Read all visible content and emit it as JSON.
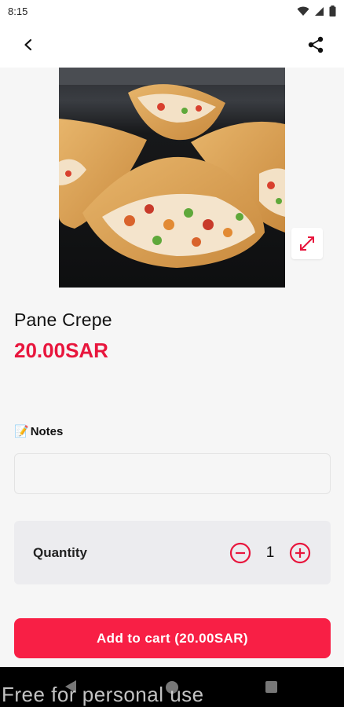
{
  "status_bar": {
    "time": "8:15",
    "icons": [
      "wifi-icon",
      "signal-icon",
      "battery-icon"
    ]
  },
  "top_bar": {
    "back_icon": "back-arrow-icon",
    "share_icon": "share-icon"
  },
  "product": {
    "name": "Pane Crepe",
    "price": "20.00SAR",
    "image": "crepe-cones-photo",
    "expand_icon": "expand-icon"
  },
  "notes": {
    "emoji": "📝",
    "label": "Notes",
    "value": "",
    "placeholder": ""
  },
  "quantity": {
    "label": "Quantity",
    "value": "1",
    "decrement_icon": "minus-circle-icon",
    "increment_icon": "plus-circle-icon"
  },
  "cart_button": {
    "label": "Add to cart (20.00SAR)"
  },
  "watermark": "Free for personal use",
  "colors": {
    "accent": "#e8163d",
    "button": "#f81f45",
    "card": "#ececef",
    "background": "#f6f6f6"
  }
}
